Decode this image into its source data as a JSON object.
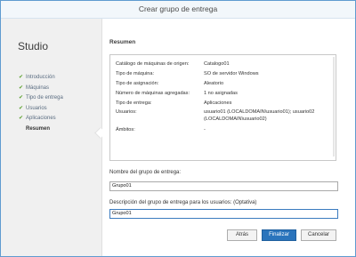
{
  "window": {
    "title": "Crear grupo de entrega"
  },
  "sidebar": {
    "brand": "Studio",
    "steps": [
      {
        "label": "Introducción",
        "done": true
      },
      {
        "label": "Máquinas",
        "done": true
      },
      {
        "label": "Tipo de entrega",
        "done": true
      },
      {
        "label": "Usuarios",
        "done": true
      },
      {
        "label": "Aplicaciones",
        "done": true
      },
      {
        "label": "Resumen",
        "done": false
      }
    ],
    "check_glyph": "✔"
  },
  "main": {
    "section_title": "Resumen",
    "summary": [
      {
        "label": "Catálogo de máquinas de origen:",
        "value": "Catalogo01"
      },
      {
        "label": "Tipo de máquina:",
        "value": "SO de servidor Windows"
      },
      {
        "label": "Tipo de asignación:",
        "value": "Aleatorio"
      },
      {
        "label": "Número de máquinas agregadas:",
        "value": "1 no asignadas"
      },
      {
        "label": "Tipo de entrega:",
        "value": "Aplicaciones"
      },
      {
        "label": "Usuarios:",
        "value": "usuario01 (LOCALDOMAIN\\usuario01); usuario02",
        "value2": "(LOCALDOMAIN\\usuario02)"
      },
      {
        "label": "Ámbitos:",
        "value": "-"
      }
    ],
    "name_field": {
      "label": "Nombre del grupo de entrega:",
      "value": "Grupo01"
    },
    "desc_field": {
      "label": "Descripción del grupo de entrega para los usuarios: (Optativa)",
      "value": "Grupo01"
    }
  },
  "buttons": {
    "back": "Atrás",
    "finish": "Finalizar",
    "cancel": "Cancelar"
  },
  "colors": {
    "accent": "#2a74bc",
    "check": "#5aa02c",
    "frame": "#5f9bd0"
  }
}
